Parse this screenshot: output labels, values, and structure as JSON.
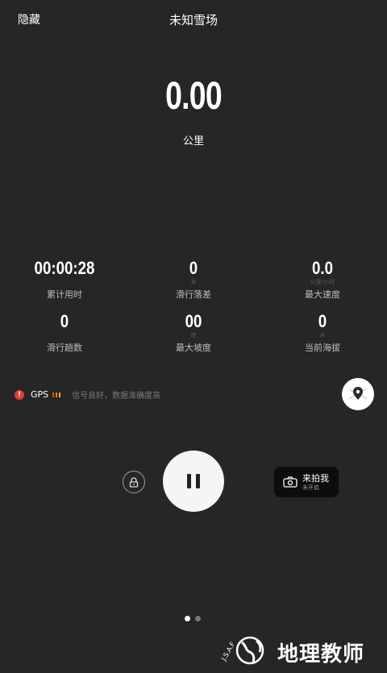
{
  "header": {
    "hide_label": "隐藏",
    "title": "未知雪场"
  },
  "main": {
    "distance_value": "0.00",
    "distance_unit": "公里"
  },
  "stats": [
    {
      "value": "00:00:28",
      "unit": "",
      "label": "累计用时"
    },
    {
      "value": "0",
      "unit": "米",
      "label": "滑行落差"
    },
    {
      "value": "0.0",
      "unit": "公里/小时",
      "label": "最大速度"
    },
    {
      "value": "0",
      "unit": "",
      "label": "滑行趟数"
    },
    {
      "value": "00",
      "unit": "度",
      "label": "最大坡度"
    },
    {
      "value": "0",
      "unit": "米",
      "label": "当前海拔"
    }
  ],
  "gps": {
    "label": "GPS",
    "message": "信号良好，数据准确度高",
    "warn_symbol": "!",
    "signal_colors": [
      "#e65100",
      "#ff8a00",
      "#ffab40"
    ]
  },
  "controls": {
    "lock_icon": "lock-icon",
    "pause_icon": "pause-icon",
    "photo_title": "来拍我",
    "photo_subtitle": "未开启",
    "map_icon": "map-pin-icon"
  },
  "pager": {
    "page_count": 2,
    "active_index": 0
  },
  "watermark": {
    "text": "地理教师"
  },
  "colors": {
    "background": "#262626",
    "button_light": "#f5f5f5",
    "warning": "#e53935"
  }
}
